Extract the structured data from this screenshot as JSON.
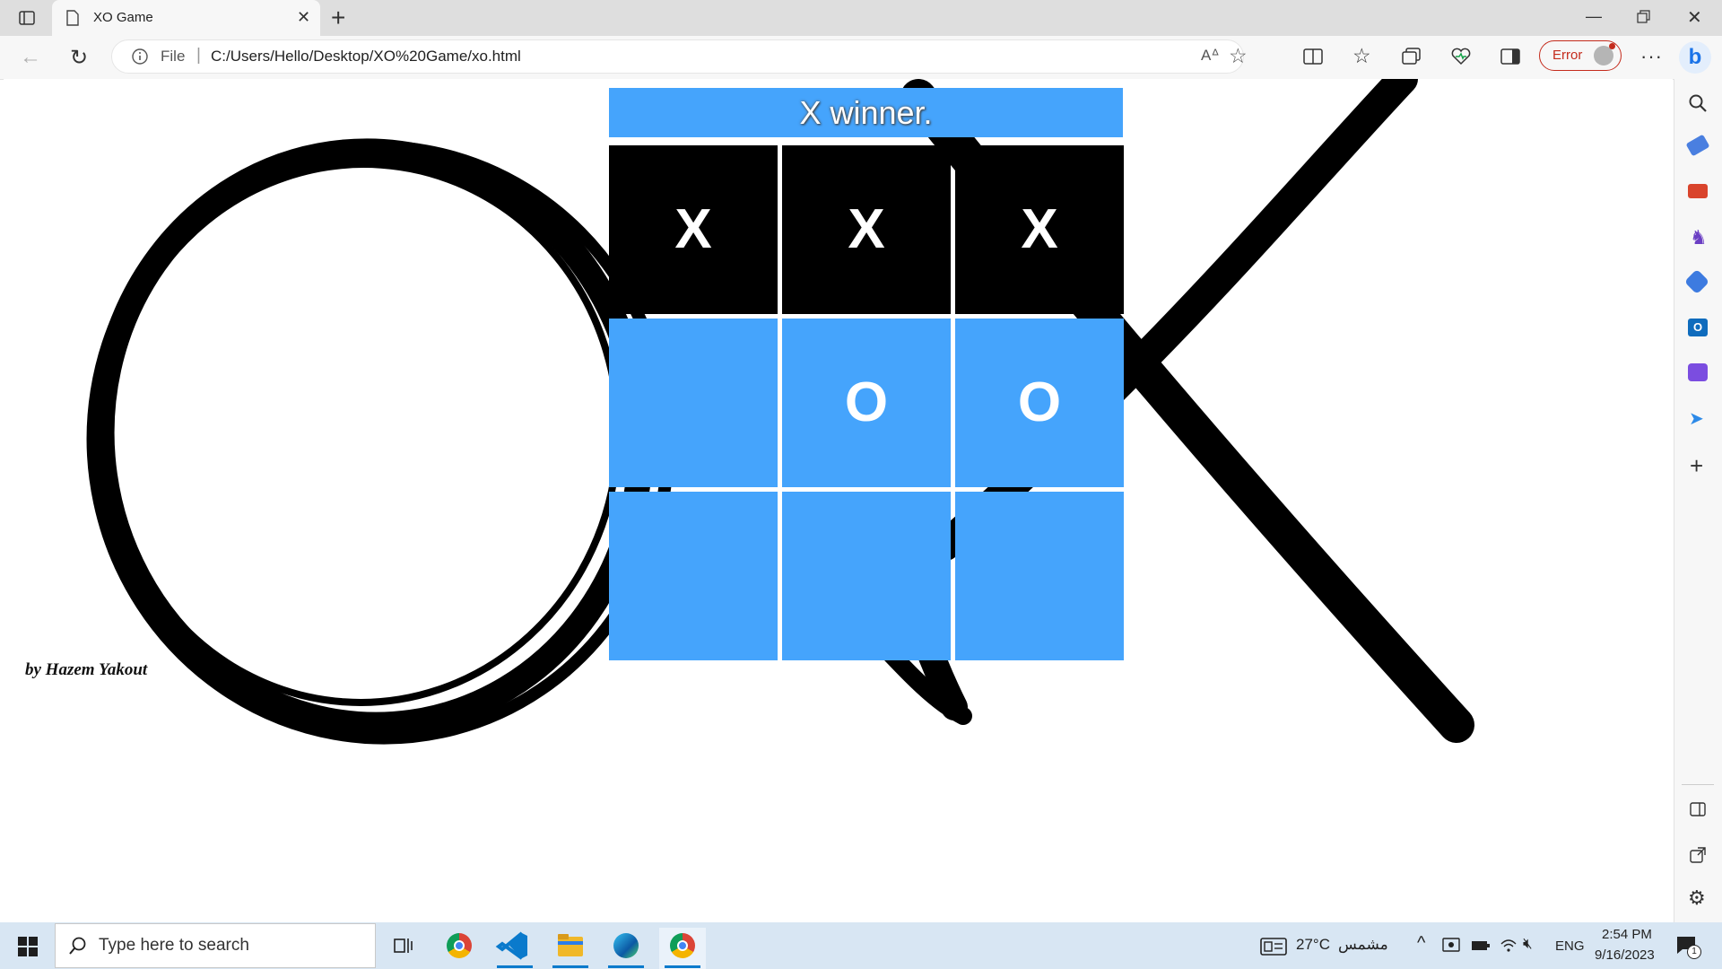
{
  "browser": {
    "tab_title": "XO Game",
    "url_scheme": "File",
    "url": "C:/Users/Hello/Desktop/XO%20Game/xo.html",
    "error_label": "Error"
  },
  "game": {
    "status": "X winner.",
    "board": [
      [
        "X",
        "X",
        "X"
      ],
      [
        "",
        "O",
        "O"
      ],
      [
        "",
        "",
        ""
      ]
    ],
    "winning_row": 0,
    "credit": "by Hazem Yakout"
  },
  "taskbar": {
    "search_placeholder": "Type here to search",
    "weather_temp": "27°C",
    "weather_text": "مشمس",
    "language": "ENG",
    "time": "2:54 PM",
    "date": "9/16/2023",
    "notification_count": "1"
  },
  "colors": {
    "cell_blue": "#45a4fc",
    "win_black": "#000000",
    "error_red": "#c42b1c"
  }
}
